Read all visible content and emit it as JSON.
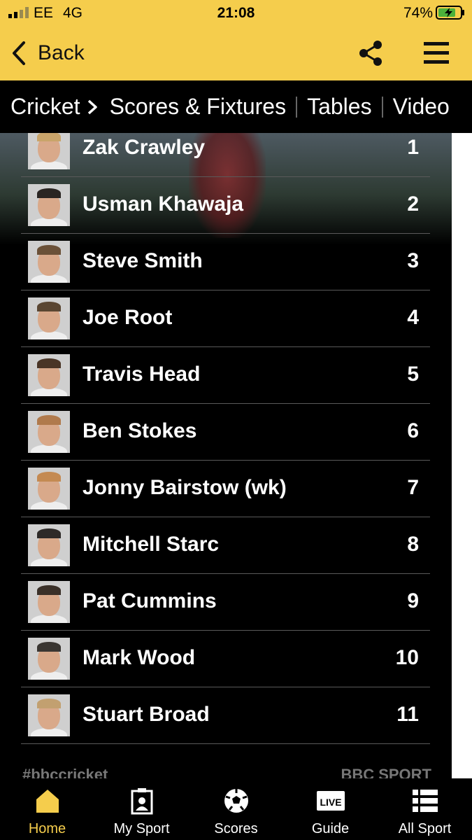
{
  "status_bar": {
    "carrier": "EE",
    "network": "4G",
    "time": "21:08",
    "battery_percent": "74%"
  },
  "header": {
    "back_label": "Back"
  },
  "subnav": {
    "crumb": "Cricket",
    "items": [
      "Scores & Fixtures",
      "Tables",
      "Video"
    ]
  },
  "players": [
    {
      "name": "Zak Crawley",
      "number": "1"
    },
    {
      "name": "Usman Khawaja",
      "number": "2"
    },
    {
      "name": "Steve Smith",
      "number": "3"
    },
    {
      "name": "Joe Root",
      "number": "4"
    },
    {
      "name": "Travis Head",
      "number": "5"
    },
    {
      "name": "Ben Stokes",
      "number": "6"
    },
    {
      "name": "Jonny Bairstow (wk)",
      "number": "7"
    },
    {
      "name": "Mitchell Starc",
      "number": "8"
    },
    {
      "name": "Pat Cummins",
      "number": "9"
    },
    {
      "name": "Mark Wood",
      "number": "10"
    },
    {
      "name": "Stuart Broad",
      "number": "11"
    }
  ],
  "footer": {
    "hashtag": "#bbccricket",
    "brand": "BBC SPORT"
  },
  "tabs": [
    {
      "label": "Home",
      "icon": "home-icon",
      "active": true
    },
    {
      "label": "My Sport",
      "icon": "my-sport-icon",
      "active": false
    },
    {
      "label": "Scores",
      "icon": "football-icon",
      "active": false
    },
    {
      "label": "Guide",
      "icon": "live-icon",
      "active": false
    },
    {
      "label": "All Sport",
      "icon": "list-icon",
      "active": false
    }
  ],
  "colors": {
    "header_yellow": "#f5cd4c",
    "background": "#000000",
    "text": "#ffffff"
  }
}
